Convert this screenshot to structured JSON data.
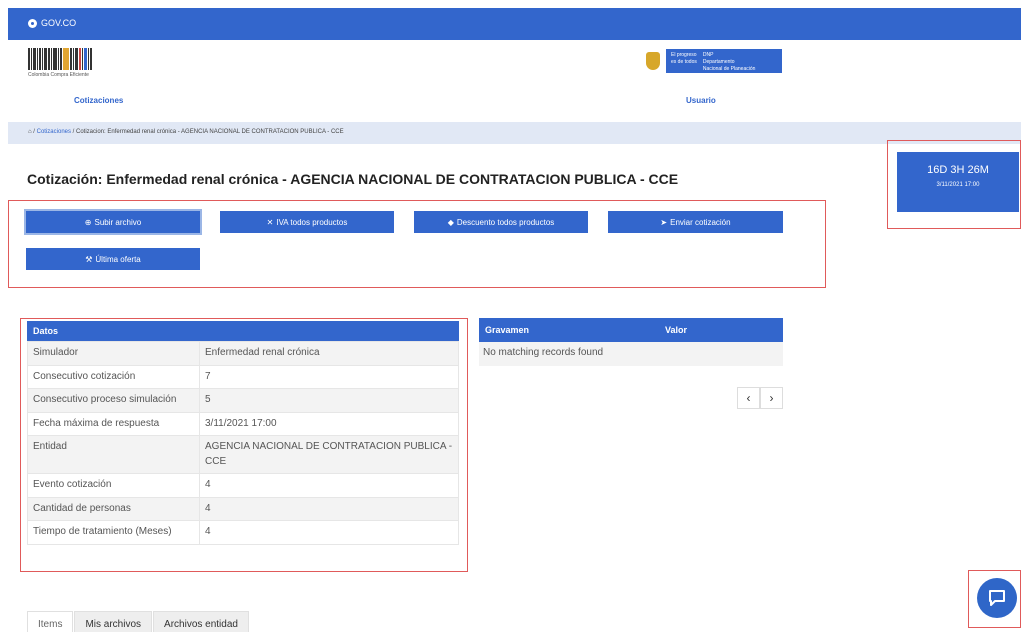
{
  "gov_bar": {
    "label": "GOV.CO"
  },
  "brand": {
    "tagline": "Colombia Compra Eficiente"
  },
  "gov_badge": {
    "line1": "El progreso",
    "line2": "es de todos",
    "line3": "DNP",
    "line4": "Departamento",
    "line5": "Nacional de Planeación"
  },
  "nav": {
    "cotizaciones": "Cotizaciones",
    "usuario": "Usuario"
  },
  "breadcrumb": {
    "home_sep": "/",
    "link": "Cotizaciones",
    "current": "/ Cotizacion: Enfermedad renal crónica - AGENCIA NACIONAL DE CONTRATACION PUBLICA - CCE"
  },
  "title": "Cotización: Enfermedad renal crónica - AGENCIA NACIONAL DE CONTRATACION PUBLICA - CCE",
  "countdown": {
    "remaining": "16D 3H 26M",
    "deadline": "3/11/2021 17:00"
  },
  "actions": {
    "subir": "Subir archivo",
    "iva": "IVA todos productos",
    "descuento": "Descuento todos productos",
    "enviar": "Enviar cotización",
    "ultima": "Última oferta"
  },
  "datos": {
    "header": "Datos",
    "rows": [
      {
        "k": "Simulador",
        "v": "Enfermedad renal crónica"
      },
      {
        "k": "Consecutivo cotización",
        "v": "7"
      },
      {
        "k": "Consecutivo proceso simulación",
        "v": "5"
      },
      {
        "k": "Fecha máxima de respuesta",
        "v": "3/11/2021 17:00"
      },
      {
        "k": "Entidad",
        "v": "AGENCIA NACIONAL DE CONTRATACION PUBLICA - CCE"
      },
      {
        "k": "Evento cotización",
        "v": "4"
      },
      {
        "k": "Cantidad de personas",
        "v": "4"
      },
      {
        "k": "Tiempo de tratamiento (Meses)",
        "v": "4"
      }
    ]
  },
  "gravamen": {
    "col1": "Gravamen",
    "col2": "Valor",
    "empty": "No matching records found",
    "prev": "‹",
    "next": "›"
  },
  "tabs": [
    "Items",
    "Mis archivos",
    "Archivos entidad"
  ]
}
